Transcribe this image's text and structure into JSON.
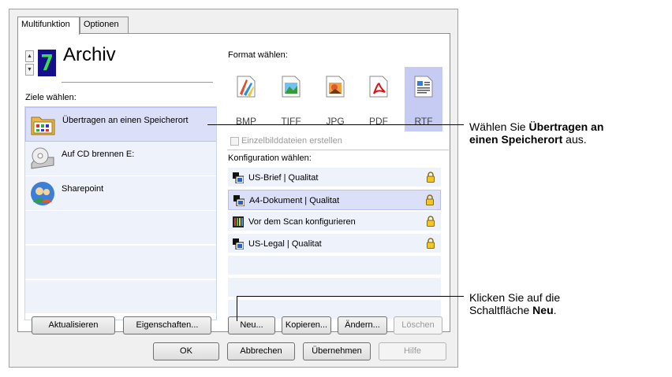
{
  "tabs": {
    "multifunktion": "Multifunktion",
    "optionen": "Optionen"
  },
  "profile": {
    "number": "7",
    "name": "Archiv"
  },
  "labels": {
    "ziele": "Ziele wählen:",
    "format": "Format wählen:",
    "konfiguration": "Konfiguration wählen:",
    "einzelbild": "Einzelbilddateien erstellen"
  },
  "destinations": [
    {
      "name": "Übertragen an einen Speicherort",
      "icon": "folder-icon"
    },
    {
      "name": "Auf CD brennen  E:",
      "icon": "cd-drive-icon"
    },
    {
      "name": "Sharepoint",
      "icon": "sharepoint-icon"
    }
  ],
  "formats": [
    "BMP",
    "TIFF",
    "JPG",
    "PDF",
    "RTF"
  ],
  "selected_format": "RTF",
  "configurations": [
    {
      "name": "US-Brief | Qualitat",
      "icon": "scanner-config-icon"
    },
    {
      "name": "A4-Dokument | Qualitat",
      "icon": "scanner-config-icon"
    },
    {
      "name": "Vor dem Scan konfigurieren",
      "icon": "configure-before-scan-icon"
    },
    {
      "name": "US-Legal | Qualitat",
      "icon": "scanner-config-icon"
    }
  ],
  "buttons": {
    "aktualisieren": "Aktualisieren",
    "eigenschaften": "Eigenschaften...",
    "neu": "Neu...",
    "kopieren": "Kopieren...",
    "aendern": "Ändern...",
    "loeschen": "Löschen",
    "ok": "OK",
    "abbrechen": "Abbrechen",
    "uebernehmen": "Übernehmen",
    "hilfe": "Hilfe"
  },
  "callouts": {
    "top": {
      "pre": "Wählen Sie ",
      "bold1": "Übertragen an",
      "bold2": "einen Speicherort",
      "post": " aus."
    },
    "bottom": {
      "line1": "Klicken Sie auf die",
      "pre": "Schaltfläche ",
      "bold": "Neu",
      "post": "."
    }
  },
  "colors": {
    "selection": "#dcdff8",
    "list": "#eef2fb",
    "lcd_bg": "#160f8c",
    "lcd_fg": "#35e24c"
  }
}
